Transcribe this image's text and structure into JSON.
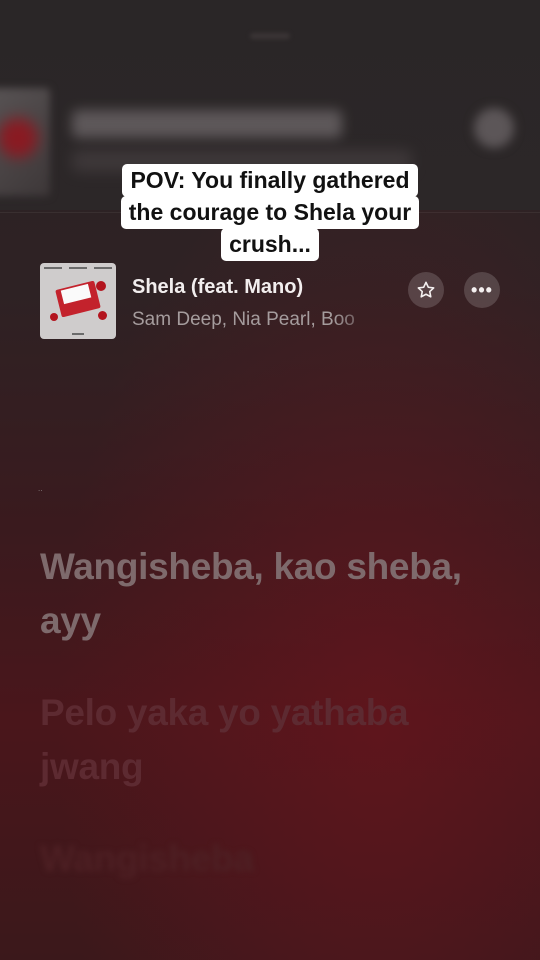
{
  "caption": {
    "lines": [
      "POV: You finally gathered",
      "the courage to Shela your",
      "crush..."
    ]
  },
  "now_playing": {
    "title": "Shela (feat. Mano)",
    "artists": "Sam Deep, Nia Pearl, Boo",
    "favorite_icon": "star-outline-icon",
    "more_icon": "more-horizontal-icon",
    "more_label": "•••"
  },
  "lyrics": {
    "current": "Wangisheba, kao sheba, ayy",
    "next": "Pelo yaka yo yathaba jwang",
    "following": "Wangisheba"
  },
  "misc": {
    "dots": ".."
  },
  "colors": {
    "background": "#2e2224",
    "accent_red": "#4a161b",
    "caption_bg": "#ffffff"
  }
}
